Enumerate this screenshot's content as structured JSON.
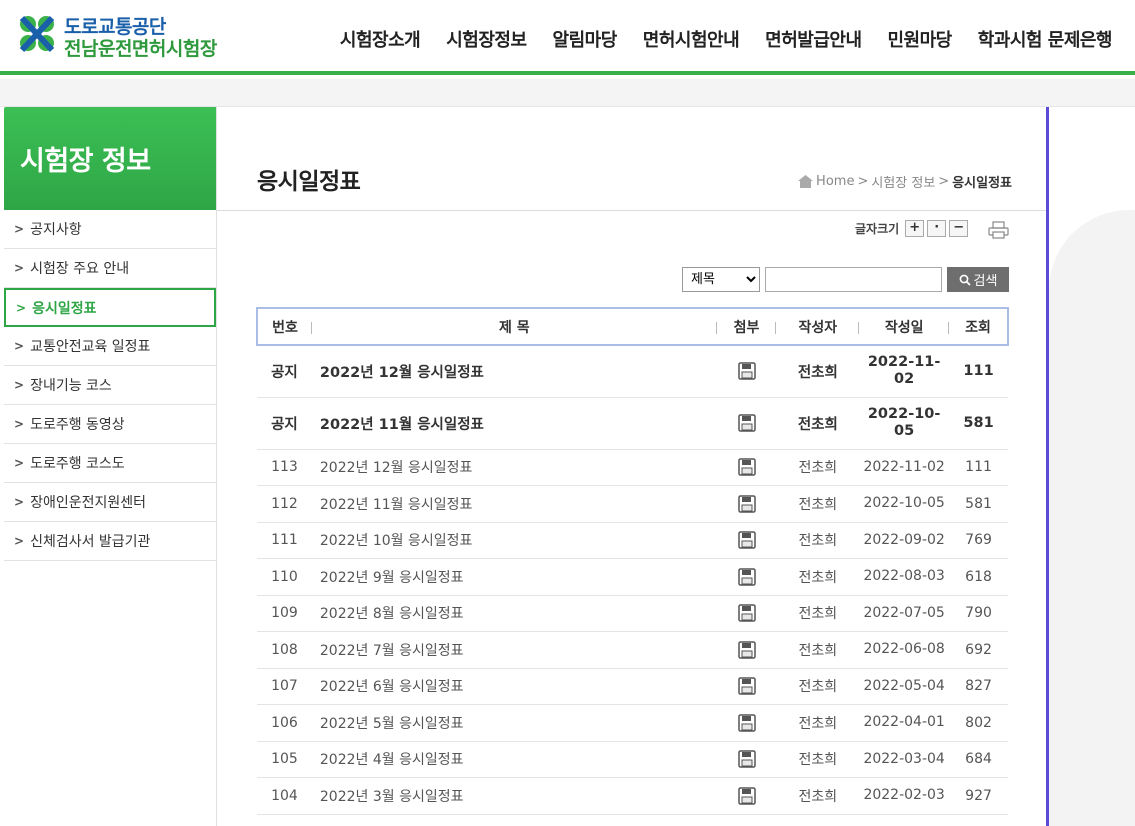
{
  "header": {
    "logo_line1": "도로교통공단",
    "logo_line2": "전남운전면허시험장",
    "nav": [
      "시험장소개",
      "시험장정보",
      "알림마당",
      "면허시험안내",
      "면허발급안내",
      "민원마당",
      "학과시험 문제은행"
    ]
  },
  "sidebar": {
    "title": "시험장 정보",
    "items": [
      {
        "label": "공지사항"
      },
      {
        "label": "시험장 주요 안내"
      },
      {
        "label": "응시일정표"
      },
      {
        "label": "교통안전교육 일정표"
      },
      {
        "label": "장내기능 코스"
      },
      {
        "label": "도로주행 동영상"
      },
      {
        "label": "도로주행 코스도"
      },
      {
        "label": "장애인운전지원센터"
      },
      {
        "label": "신체검사서 발급기관"
      }
    ]
  },
  "main": {
    "page_title": "응시일정표",
    "breadcrumb": {
      "home": "Home",
      "section": "시험장 정보",
      "current": "응시일정표",
      "separator": ">"
    },
    "font_size_label": "글자크기",
    "font_buttons": [
      "+",
      "·",
      "−"
    ],
    "search": {
      "option": "제목",
      "button_label": "검색",
      "value": ""
    },
    "table": {
      "headers": [
        "번호",
        "제 목",
        "첨부",
        "작성자",
        "작성일",
        "조회"
      ],
      "notice_rows": [
        {
          "no": "공지",
          "subject": "2022년 12월 응시일정표",
          "author": "전초희",
          "date": "2022-11-02",
          "views": "111"
        },
        {
          "no": "공지",
          "subject": "2022년 11월 응시일정표",
          "author": "전초희",
          "date": "2022-10-05",
          "views": "581"
        }
      ],
      "rows": [
        {
          "no": "113",
          "subject": "2022년 12월 응시일정표",
          "author": "전초희",
          "date": "2022-11-02",
          "views": "111"
        },
        {
          "no": "112",
          "subject": "2022년 11월 응시일정표",
          "author": "전초희",
          "date": "2022-10-05",
          "views": "581"
        },
        {
          "no": "111",
          "subject": "2022년 10월 응시일정표",
          "author": "전초희",
          "date": "2022-09-02",
          "views": "769"
        },
        {
          "no": "110",
          "subject": "2022년 9월 응시일정표",
          "author": "전초희",
          "date": "2022-08-03",
          "views": "618"
        },
        {
          "no": "109",
          "subject": "2022년 8월 응시일정표",
          "author": "전초희",
          "date": "2022-07-05",
          "views": "790"
        },
        {
          "no": "108",
          "subject": "2022년 7월 응시일정표",
          "author": "전초희",
          "date": "2022-06-08",
          "views": "692"
        },
        {
          "no": "107",
          "subject": "2022년 6월 응시일정표",
          "author": "전초희",
          "date": "2022-05-04",
          "views": "827"
        },
        {
          "no": "106",
          "subject": "2022년 5월 응시일정표",
          "author": "전초희",
          "date": "2022-04-01",
          "views": "802"
        },
        {
          "no": "105",
          "subject": "2022년 4월 응시일정표",
          "author": "전초희",
          "date": "2022-03-04",
          "views": "684"
        },
        {
          "no": "104",
          "subject": "2022년 3월 응시일정표",
          "author": "전초희",
          "date": "2022-02-03",
          "views": "927"
        }
      ]
    }
  },
  "colors": {
    "brand_green": "#2ea646",
    "brand_blue": "#1a5faa",
    "table_border": "#a9bde6",
    "accent_line": "#5b4bd6"
  },
  "icons": {
    "attachment": "floppy-disk-icon",
    "print": "printer-icon",
    "home": "home-icon",
    "search": "magnifier-icon"
  }
}
